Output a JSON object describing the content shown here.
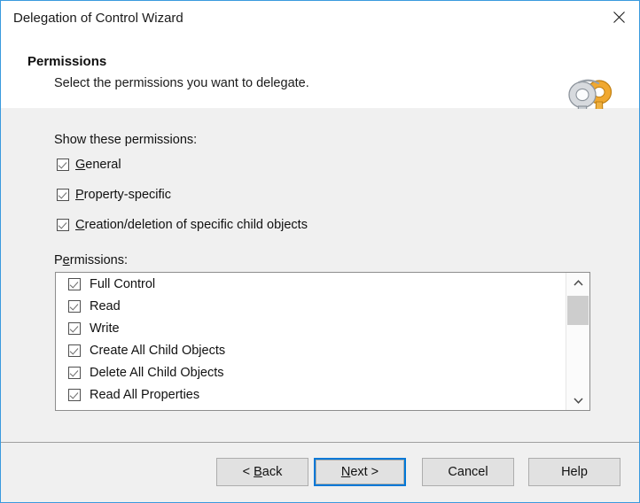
{
  "window": {
    "title": "Delegation of Control Wizard",
    "close_label": "Close",
    "accent_color": "#3a9ade"
  },
  "header": {
    "title": "Permissions",
    "subtitle": "Select the permissions you want to delegate.",
    "icon": "keys-icon"
  },
  "body": {
    "show_permissions_label": "Show these permissions:",
    "show_permissions_options": [
      {
        "label_before": "",
        "accel": "G",
        "label_after": "eneral",
        "checked": true
      },
      {
        "label_before": "",
        "accel": "P",
        "label_after": "roperty-specific",
        "checked": true
      },
      {
        "label_before": "",
        "accel": "C",
        "label_after": "reation/deletion of specific child objects",
        "checked": true
      }
    ],
    "permissions_label_before": "P",
    "permissions_label_accel": "e",
    "permissions_label_after": "rmissions:",
    "permissions_items": [
      {
        "label": "Full Control",
        "checked": true
      },
      {
        "label": "Read",
        "checked": true
      },
      {
        "label": "Write",
        "checked": true
      },
      {
        "label": "Create All Child Objects",
        "checked": true
      },
      {
        "label": "Delete All Child Objects",
        "checked": true
      },
      {
        "label": "Read All Properties",
        "checked": true
      }
    ],
    "scrollbar": {
      "up_arrow": "chevron-up",
      "down_arrow": "chevron-down",
      "thumb_position_percent": 5
    }
  },
  "footer": {
    "buttons": [
      {
        "id": "back",
        "before": "< ",
        "accel": "B",
        "after": "ack",
        "default": false
      },
      {
        "id": "next",
        "before": "",
        "accel": "N",
        "after": "ext >",
        "default": true
      },
      {
        "id": "cancel",
        "before": "Cancel",
        "accel": "",
        "after": "",
        "default": false
      },
      {
        "id": "help",
        "before": "Help",
        "accel": "",
        "after": "",
        "default": false
      }
    ]
  }
}
